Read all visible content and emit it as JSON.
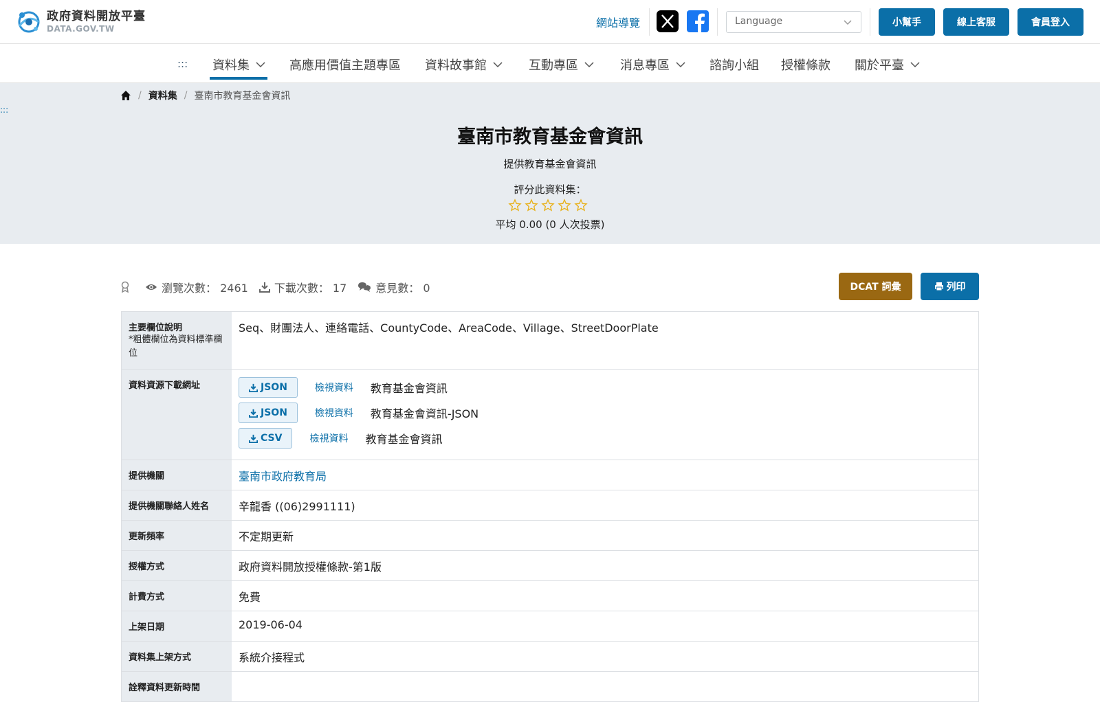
{
  "header": {
    "logo_zh": "政府資料開放平臺",
    "logo_en": "DATA.GOV.TW",
    "sitemap": "網站導覽",
    "language_placeholder": "Language",
    "buttons": [
      "小幫手",
      "線上客服",
      "會員登入"
    ]
  },
  "nav": {
    "accesskey": ":::",
    "items": [
      "資料集",
      "高應用價值主題專區",
      "資料故事館",
      "互動專區",
      "消息專區",
      "諮詢小組",
      "授權條款",
      "關於平臺"
    ]
  },
  "breadcrumb": {
    "level1": "資料集",
    "current": "臺南市教育基金會資訊",
    "skip": ":::"
  },
  "dataset": {
    "title": "臺南市教育基金會資訊",
    "description": "提供教育基金會資訊",
    "rate_label": "評分此資料集：",
    "rating_value": 0,
    "rating_max": 5,
    "average_text": "平均 0.00 (0 人次投票)"
  },
  "stats": {
    "views": "瀏覽次數： 2461",
    "downloads": "下載次數： 17",
    "comments": "意見數： 0"
  },
  "actions": {
    "dcat": "DCAT 詞彙",
    "print": "列印"
  },
  "table": {
    "fields_label": "主要欄位說明",
    "fields_note": "*粗體欄位為資料標準欄位",
    "fields_value": "Seq、財團法人、連絡電話、CountyCode、AreaCode、Village、StreetDoorPlate",
    "resources_label": "資料資源下載網址",
    "resources": [
      {
        "format": "JSON",
        "view": "檢視資料",
        "name": "教育基金會資訊"
      },
      {
        "format": "JSON",
        "view": "檢視資料",
        "name": "教育基金會資訊-JSON"
      },
      {
        "format": "CSV",
        "view": "檢視資料",
        "name": "教育基金會資訊"
      }
    ],
    "rows": [
      {
        "label": "提供機關",
        "value": "臺南市政府教育局"
      },
      {
        "label": "提供機關聯絡人姓名",
        "value": "辛龍香 ((06)2991111)"
      },
      {
        "label": "更新頻率",
        "value": "不定期更新"
      },
      {
        "label": "授權方式",
        "value": "政府資料開放授權條款-第1版"
      },
      {
        "label": "計費方式",
        "value": "免費"
      },
      {
        "label": "上架日期",
        "value": "2019-06-04"
      },
      {
        "label": "資料集上架方式",
        "value": "系統介接程式"
      },
      {
        "label": "詮釋資料更新時間",
        "value": ""
      }
    ]
  },
  "colors": {
    "primary": "#0b6fa8",
    "dcat": "#9a6812",
    "hero_bg": "#e8ecf0",
    "star": "#e8b21f"
  }
}
